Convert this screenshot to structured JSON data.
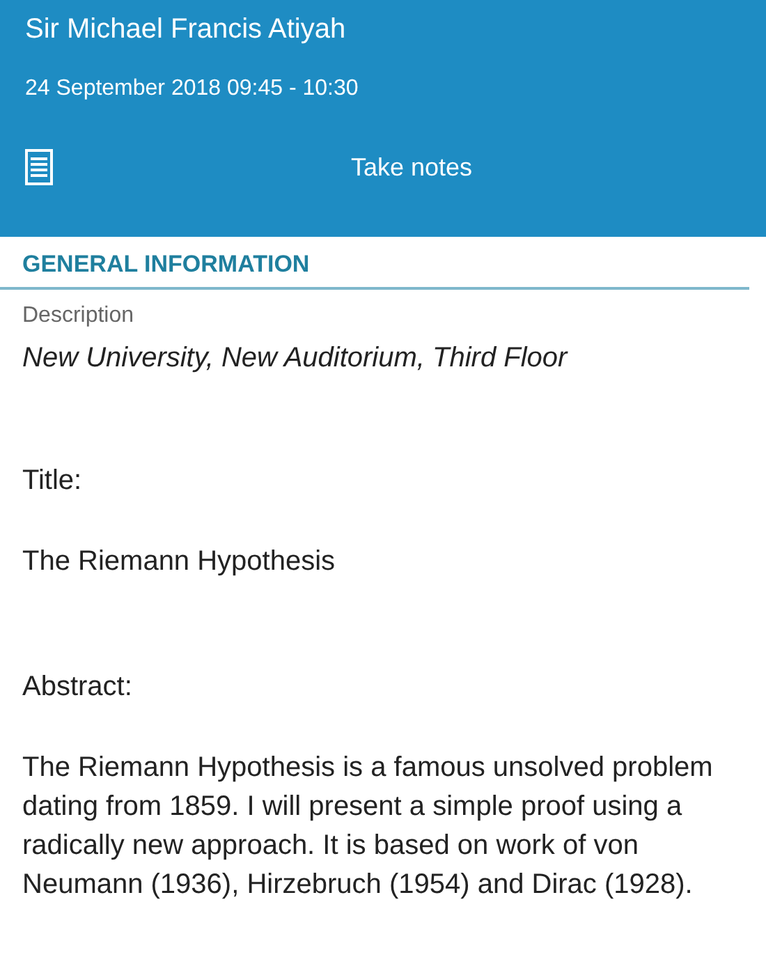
{
  "header": {
    "name": "Sir Michael Francis Atiyah",
    "datetime": "24 September 2018 09:45 - 10:30",
    "action": "Take notes"
  },
  "section": {
    "heading": "GENERAL INFORMATION",
    "label": "Description",
    "location": "New University, New Auditorium, Third Floor"
  },
  "fields": [
    {
      "label": "Title:",
      "value": "The Riemann Hypothesis"
    },
    {
      "label": "Abstract:",
      "value": "The Riemann Hypothesis is a famous unsolved problem dating from 1859. I will present a simple proof using a radically new approach. It is based on work of von Neumann (1936), Hirzebruch (1954) and Dirac (1928)."
    }
  ]
}
